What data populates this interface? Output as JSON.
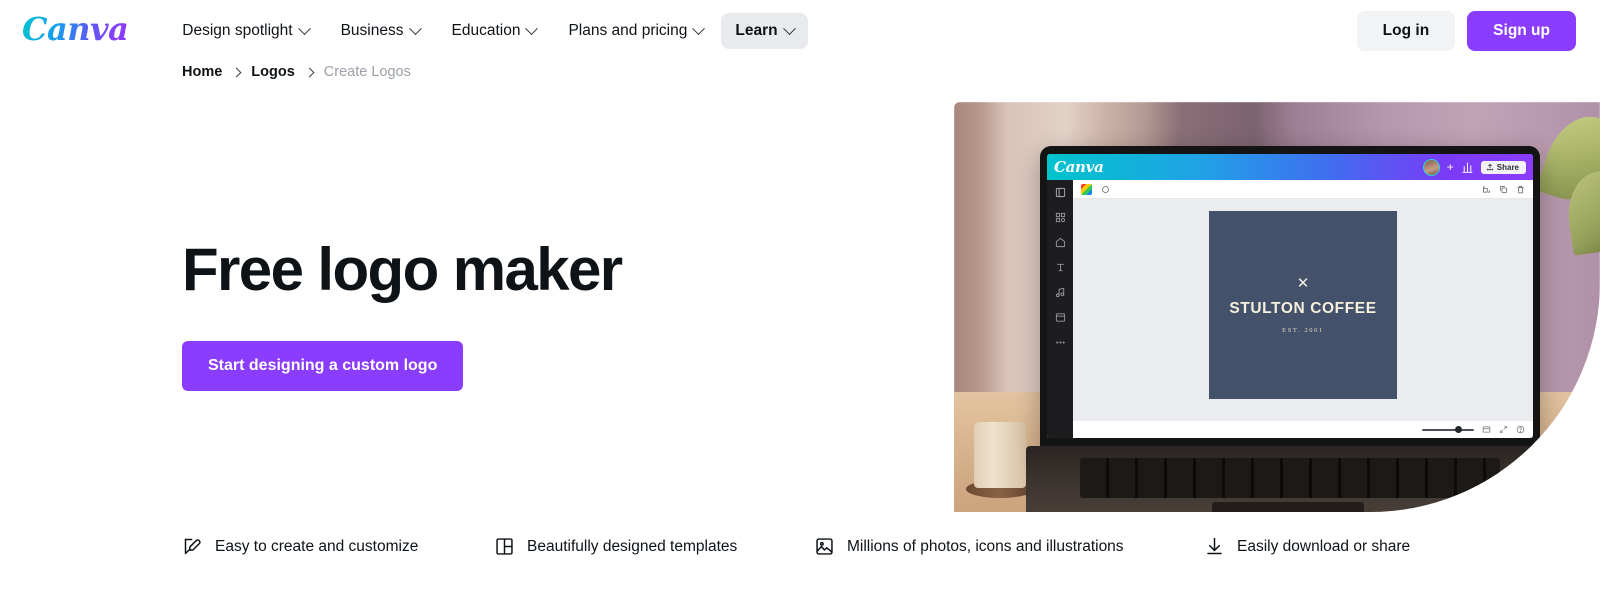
{
  "header": {
    "logo_text": "Canva",
    "nav": [
      {
        "label": "Design spotlight",
        "has_caret": true,
        "active": false
      },
      {
        "label": "Business",
        "has_caret": true,
        "active": false
      },
      {
        "label": "Education",
        "has_caret": true,
        "active": false
      },
      {
        "label": "Plans and pricing",
        "has_caret": true,
        "active": false
      },
      {
        "label": "Learn",
        "has_caret": true,
        "active": true
      }
    ],
    "login_label": "Log in",
    "signup_label": "Sign up",
    "signup_color": "#8b3dff",
    "login_bg": "#f2f3f5"
  },
  "breadcrumb": {
    "items": [
      {
        "label": "Home",
        "current": false
      },
      {
        "label": "Logos",
        "current": false
      },
      {
        "label": "Create Logos",
        "current": true
      }
    ]
  },
  "hero": {
    "title": "Free logo maker",
    "cta_label": "Start designing a custom logo",
    "cta_color": "#8b3dff"
  },
  "hero_image": {
    "editor": {
      "logo_text": "Canva",
      "share_label": "Share"
    },
    "design": {
      "mark": "✕",
      "name": "STULTON COFFEE",
      "established": "EST. 2001",
      "background_color": "#43516b",
      "text_color": "#f6f0dc"
    }
  },
  "features": [
    {
      "icon": "pencil-edit-icon",
      "label": "Easy to create and customize"
    },
    {
      "icon": "templates-layout-icon",
      "label": "Beautifully designed templates"
    },
    {
      "icon": "photo-image-icon",
      "label": "Millions of photos, icons and illustrations"
    },
    {
      "icon": "download-icon",
      "label": "Easily download or share"
    }
  ]
}
